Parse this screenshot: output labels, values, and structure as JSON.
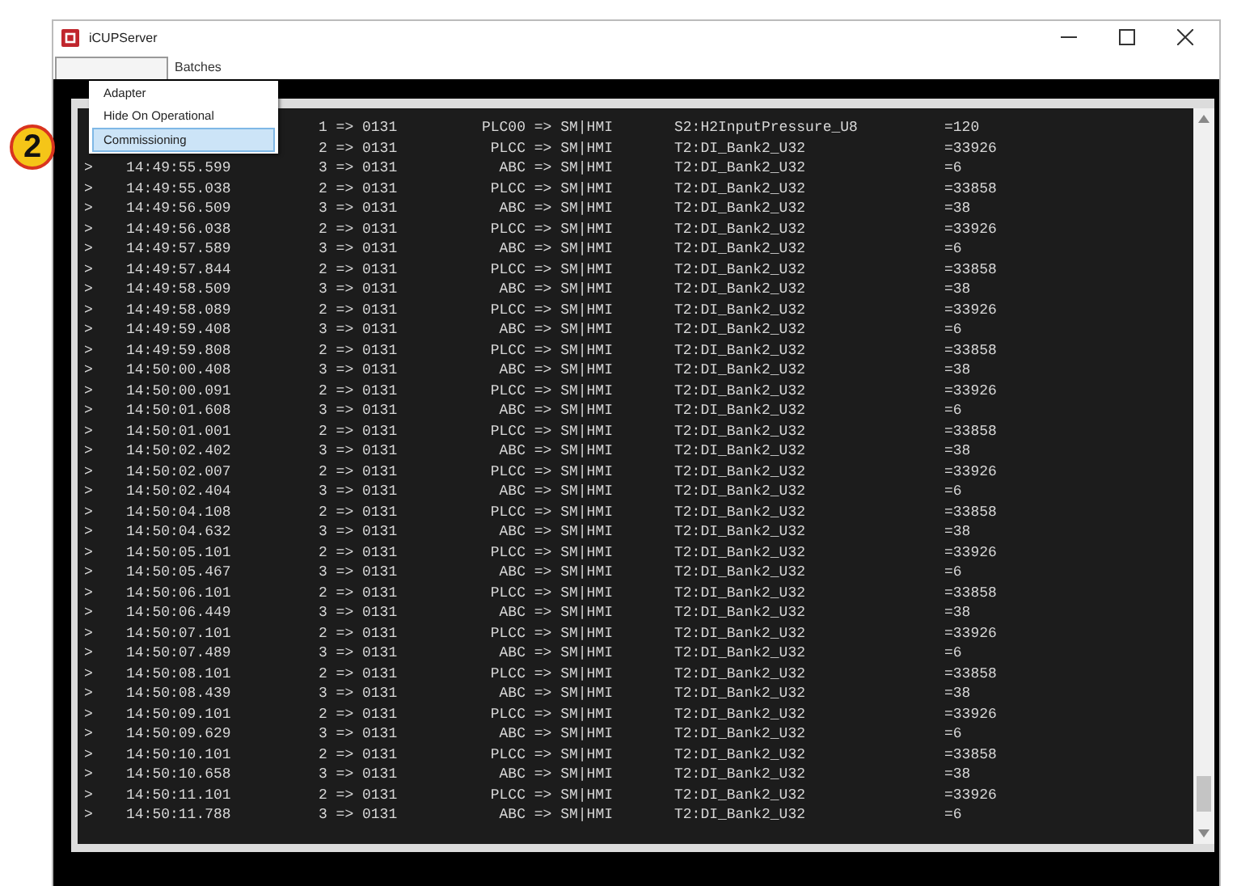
{
  "window": {
    "title": "iCUPServer"
  },
  "menu_bar": [
    {
      "open": true
    },
    {
      "label": "Batches",
      "open": false
    }
  ],
  "dropdown": [
    {
      "label": "Adapter",
      "selected": false
    },
    {
      "label": "Hide On Operational",
      "selected": false
    },
    {
      "label": "Commissioning",
      "selected": true
    }
  ],
  "step_badge": "2",
  "log": [
    {
      "route": "1 => 0131",
      "link": "PLC00 => SM|HMI",
      "tag": "S2:H2InputPressure_U8",
      "value": "=120"
    },
    {
      "route": "2 => 0131",
      "link": "PLCC => SM|HMI",
      "tag": "T2:DI_Bank2_U32",
      "value": "=33926"
    },
    {
      "prefix": ">",
      "time": "14:49:55.599",
      "route": "3 => 0131",
      "link": "ABC => SM|HMI",
      "tag": "T2:DI_Bank2_U32",
      "value": "=6"
    },
    {
      "prefix": ">",
      "time": "14:49:55.038",
      "route": "2 => 0131",
      "link": "PLCC => SM|HMI",
      "tag": "T2:DI_Bank2_U32",
      "value": "=33858"
    },
    {
      "prefix": ">",
      "time": "14:49:56.509",
      "route": "3 => 0131",
      "link": "ABC => SM|HMI",
      "tag": "T2:DI_Bank2_U32",
      "value": "=38"
    },
    {
      "prefix": ">",
      "time": "14:49:56.038",
      "route": "2 => 0131",
      "link": "PLCC => SM|HMI",
      "tag": "T2:DI_Bank2_U32",
      "value": "=33926"
    },
    {
      "prefix": ">",
      "time": "14:49:57.589",
      "route": "3 => 0131",
      "link": "ABC => SM|HMI",
      "tag": "T2:DI_Bank2_U32",
      "value": "=6"
    },
    {
      "prefix": ">",
      "time": "14:49:57.844",
      "route": "2 => 0131",
      "link": "PLCC => SM|HMI",
      "tag": "T2:DI_Bank2_U32",
      "value": "=33858"
    },
    {
      "prefix": ">",
      "time": "14:49:58.509",
      "route": "3 => 0131",
      "link": "ABC => SM|HMI",
      "tag": "T2:DI_Bank2_U32",
      "value": "=38"
    },
    {
      "prefix": ">",
      "time": "14:49:58.089",
      "route": "2 => 0131",
      "link": "PLCC => SM|HMI",
      "tag": "T2:DI_Bank2_U32",
      "value": "=33926"
    },
    {
      "prefix": ">",
      "time": "14:49:59.408",
      "route": "3 => 0131",
      "link": "ABC => SM|HMI",
      "tag": "T2:DI_Bank2_U32",
      "value": "=6"
    },
    {
      "prefix": ">",
      "time": "14:49:59.808",
      "route": "2 => 0131",
      "link": "PLCC => SM|HMI",
      "tag": "T2:DI_Bank2_U32",
      "value": "=33858"
    },
    {
      "prefix": ">",
      "time": "14:50:00.408",
      "route": "3 => 0131",
      "link": "ABC => SM|HMI",
      "tag": "T2:DI_Bank2_U32",
      "value": "=38"
    },
    {
      "prefix": ">",
      "time": "14:50:00.091",
      "route": "2 => 0131",
      "link": "PLCC => SM|HMI",
      "tag": "T2:DI_Bank2_U32",
      "value": "=33926"
    },
    {
      "prefix": ">",
      "time": "14:50:01.608",
      "route": "3 => 0131",
      "link": "ABC => SM|HMI",
      "tag": "T2:DI_Bank2_U32",
      "value": "=6"
    },
    {
      "prefix": ">",
      "time": "14:50:01.001",
      "route": "2 => 0131",
      "link": "PLCC => SM|HMI",
      "tag": "T2:DI_Bank2_U32",
      "value": "=33858"
    },
    {
      "prefix": ">",
      "time": "14:50:02.402",
      "route": "3 => 0131",
      "link": "ABC => SM|HMI",
      "tag": "T2:DI_Bank2_U32",
      "value": "=38"
    },
    {
      "prefix": ">",
      "time": "14:50:02.007",
      "route": "2 => 0131",
      "link": "PLCC => SM|HMI",
      "tag": "T2:DI_Bank2_U32",
      "value": "=33926"
    },
    {
      "prefix": ">",
      "time": "14:50:02.404",
      "route": "3 => 0131",
      "link": "ABC => SM|HMI",
      "tag": "T2:DI_Bank2_U32",
      "value": "=6"
    },
    {
      "prefix": ">",
      "time": "14:50:04.108",
      "route": "2 => 0131",
      "link": "PLCC => SM|HMI",
      "tag": "T2:DI_Bank2_U32",
      "value": "=33858"
    },
    {
      "prefix": ">",
      "time": "14:50:04.632",
      "route": "3 => 0131",
      "link": "ABC => SM|HMI",
      "tag": "T2:DI_Bank2_U32",
      "value": "=38"
    },
    {
      "prefix": ">",
      "time": "14:50:05.101",
      "route": "2 => 0131",
      "link": "PLCC => SM|HMI",
      "tag": "T2:DI_Bank2_U32",
      "value": "=33926"
    },
    {
      "prefix": ">",
      "time": "14:50:05.467",
      "route": "3 => 0131",
      "link": "ABC => SM|HMI",
      "tag": "T2:DI_Bank2_U32",
      "value": "=6"
    },
    {
      "prefix": ">",
      "time": "14:50:06.101",
      "route": "2 => 0131",
      "link": "PLCC => SM|HMI",
      "tag": "T2:DI_Bank2_U32",
      "value": "=33858"
    },
    {
      "prefix": ">",
      "time": "14:50:06.449",
      "route": "3 => 0131",
      "link": "ABC => SM|HMI",
      "tag": "T2:DI_Bank2_U32",
      "value": "=38"
    },
    {
      "prefix": ">",
      "time": "14:50:07.101",
      "route": "2 => 0131",
      "link": "PLCC => SM|HMI",
      "tag": "T2:DI_Bank2_U32",
      "value": "=33926"
    },
    {
      "prefix": ">",
      "time": "14:50:07.489",
      "route": "3 => 0131",
      "link": "ABC => SM|HMI",
      "tag": "T2:DI_Bank2_U32",
      "value": "=6"
    },
    {
      "prefix": ">",
      "time": "14:50:08.101",
      "route": "2 => 0131",
      "link": "PLCC => SM|HMI",
      "tag": "T2:DI_Bank2_U32",
      "value": "=33858"
    },
    {
      "prefix": ">",
      "time": "14:50:08.439",
      "route": "3 => 0131",
      "link": "ABC => SM|HMI",
      "tag": "T2:DI_Bank2_U32",
      "value": "=38"
    },
    {
      "prefix": ">",
      "time": "14:50:09.101",
      "route": "2 => 0131",
      "link": "PLCC => SM|HMI",
      "tag": "T2:DI_Bank2_U32",
      "value": "=33926"
    },
    {
      "prefix": ">",
      "time": "14:50:09.629",
      "route": "3 => 0131",
      "link": "ABC => SM|HMI",
      "tag": "T2:DI_Bank2_U32",
      "value": "=6"
    },
    {
      "prefix": ">",
      "time": "14:50:10.101",
      "route": "2 => 0131",
      "link": "PLCC => SM|HMI",
      "tag": "T2:DI_Bank2_U32",
      "value": "=33858"
    },
    {
      "prefix": ">",
      "time": "14:50:10.658",
      "route": "3 => 0131",
      "link": "ABC => SM|HMI",
      "tag": "T2:DI_Bank2_U32",
      "value": "=38"
    },
    {
      "prefix": ">",
      "time": "14:50:11.101",
      "route": "2 => 0131",
      "link": "PLCC => SM|HMI",
      "tag": "T2:DI_Bank2_U32",
      "value": "=33926"
    },
    {
      "prefix": ">",
      "time": "14:50:11.788",
      "route": "3 => 0131",
      "link": "ABC => SM|HMI",
      "tag": "T2:DI_Bank2_U32",
      "value": "=6"
    }
  ]
}
